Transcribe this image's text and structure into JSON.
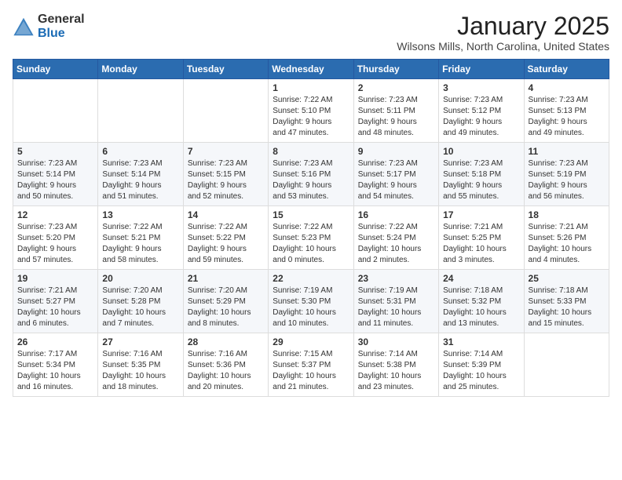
{
  "header": {
    "logo_general": "General",
    "logo_blue": "Blue",
    "month": "January 2025",
    "location": "Wilsons Mills, North Carolina, United States"
  },
  "weekdays": [
    "Sunday",
    "Monday",
    "Tuesday",
    "Wednesday",
    "Thursday",
    "Friday",
    "Saturday"
  ],
  "weeks": [
    [
      {
        "day": "",
        "info": ""
      },
      {
        "day": "",
        "info": ""
      },
      {
        "day": "",
        "info": ""
      },
      {
        "day": "1",
        "info": "Sunrise: 7:22 AM\nSunset: 5:10 PM\nDaylight: 9 hours\nand 47 minutes."
      },
      {
        "day": "2",
        "info": "Sunrise: 7:23 AM\nSunset: 5:11 PM\nDaylight: 9 hours\nand 48 minutes."
      },
      {
        "day": "3",
        "info": "Sunrise: 7:23 AM\nSunset: 5:12 PM\nDaylight: 9 hours\nand 49 minutes."
      },
      {
        "day": "4",
        "info": "Sunrise: 7:23 AM\nSunset: 5:13 PM\nDaylight: 9 hours\nand 49 minutes."
      }
    ],
    [
      {
        "day": "5",
        "info": "Sunrise: 7:23 AM\nSunset: 5:14 PM\nDaylight: 9 hours\nand 50 minutes."
      },
      {
        "day": "6",
        "info": "Sunrise: 7:23 AM\nSunset: 5:14 PM\nDaylight: 9 hours\nand 51 minutes."
      },
      {
        "day": "7",
        "info": "Sunrise: 7:23 AM\nSunset: 5:15 PM\nDaylight: 9 hours\nand 52 minutes."
      },
      {
        "day": "8",
        "info": "Sunrise: 7:23 AM\nSunset: 5:16 PM\nDaylight: 9 hours\nand 53 minutes."
      },
      {
        "day": "9",
        "info": "Sunrise: 7:23 AM\nSunset: 5:17 PM\nDaylight: 9 hours\nand 54 minutes."
      },
      {
        "day": "10",
        "info": "Sunrise: 7:23 AM\nSunset: 5:18 PM\nDaylight: 9 hours\nand 55 minutes."
      },
      {
        "day": "11",
        "info": "Sunrise: 7:23 AM\nSunset: 5:19 PM\nDaylight: 9 hours\nand 56 minutes."
      }
    ],
    [
      {
        "day": "12",
        "info": "Sunrise: 7:23 AM\nSunset: 5:20 PM\nDaylight: 9 hours\nand 57 minutes."
      },
      {
        "day": "13",
        "info": "Sunrise: 7:22 AM\nSunset: 5:21 PM\nDaylight: 9 hours\nand 58 minutes."
      },
      {
        "day": "14",
        "info": "Sunrise: 7:22 AM\nSunset: 5:22 PM\nDaylight: 9 hours\nand 59 minutes."
      },
      {
        "day": "15",
        "info": "Sunrise: 7:22 AM\nSunset: 5:23 PM\nDaylight: 10 hours\nand 0 minutes."
      },
      {
        "day": "16",
        "info": "Sunrise: 7:22 AM\nSunset: 5:24 PM\nDaylight: 10 hours\nand 2 minutes."
      },
      {
        "day": "17",
        "info": "Sunrise: 7:21 AM\nSunset: 5:25 PM\nDaylight: 10 hours\nand 3 minutes."
      },
      {
        "day": "18",
        "info": "Sunrise: 7:21 AM\nSunset: 5:26 PM\nDaylight: 10 hours\nand 4 minutes."
      }
    ],
    [
      {
        "day": "19",
        "info": "Sunrise: 7:21 AM\nSunset: 5:27 PM\nDaylight: 10 hours\nand 6 minutes."
      },
      {
        "day": "20",
        "info": "Sunrise: 7:20 AM\nSunset: 5:28 PM\nDaylight: 10 hours\nand 7 minutes."
      },
      {
        "day": "21",
        "info": "Sunrise: 7:20 AM\nSunset: 5:29 PM\nDaylight: 10 hours\nand 8 minutes."
      },
      {
        "day": "22",
        "info": "Sunrise: 7:19 AM\nSunset: 5:30 PM\nDaylight: 10 hours\nand 10 minutes."
      },
      {
        "day": "23",
        "info": "Sunrise: 7:19 AM\nSunset: 5:31 PM\nDaylight: 10 hours\nand 11 minutes."
      },
      {
        "day": "24",
        "info": "Sunrise: 7:18 AM\nSunset: 5:32 PM\nDaylight: 10 hours\nand 13 minutes."
      },
      {
        "day": "25",
        "info": "Sunrise: 7:18 AM\nSunset: 5:33 PM\nDaylight: 10 hours\nand 15 minutes."
      }
    ],
    [
      {
        "day": "26",
        "info": "Sunrise: 7:17 AM\nSunset: 5:34 PM\nDaylight: 10 hours\nand 16 minutes."
      },
      {
        "day": "27",
        "info": "Sunrise: 7:16 AM\nSunset: 5:35 PM\nDaylight: 10 hours\nand 18 minutes."
      },
      {
        "day": "28",
        "info": "Sunrise: 7:16 AM\nSunset: 5:36 PM\nDaylight: 10 hours\nand 20 minutes."
      },
      {
        "day": "29",
        "info": "Sunrise: 7:15 AM\nSunset: 5:37 PM\nDaylight: 10 hours\nand 21 minutes."
      },
      {
        "day": "30",
        "info": "Sunrise: 7:14 AM\nSunset: 5:38 PM\nDaylight: 10 hours\nand 23 minutes."
      },
      {
        "day": "31",
        "info": "Sunrise: 7:14 AM\nSunset: 5:39 PM\nDaylight: 10 hours\nand 25 minutes."
      },
      {
        "day": "",
        "info": ""
      }
    ]
  ]
}
